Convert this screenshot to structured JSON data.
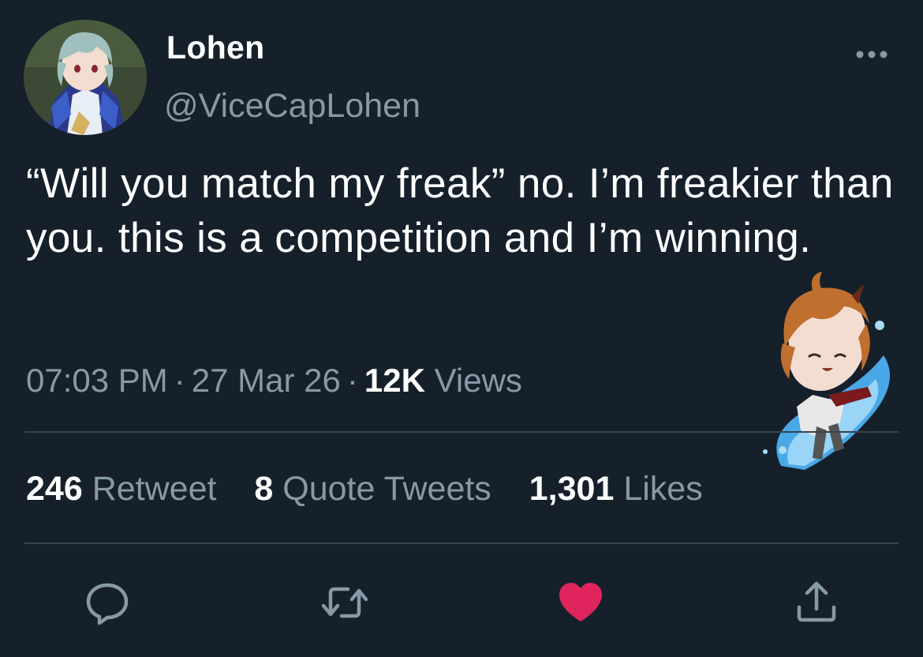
{
  "author": {
    "display_name": "Lohen",
    "handle": "@ViceCapLohen",
    "avatar_icon": "avatar-image"
  },
  "tweet": {
    "text": "“Will you match my freak” no. I’m freakier than you. this is a competition and I’m winning.",
    "time": "07:03 PM",
    "date": "27 Mar 26",
    "views_count": "12K",
    "views_label": "Views"
  },
  "stats": {
    "retweets_count": "246",
    "retweets_label": "Retweet",
    "quotes_count": "8",
    "quotes_label": "Quote Tweets",
    "likes_count": "1,301",
    "likes_label": "Likes"
  },
  "actions": {
    "reply_icon": "reply-icon",
    "retweet_icon": "retweet-icon",
    "like_icon": "heart-icon",
    "share_icon": "share-icon",
    "more_icon": "more-icon"
  },
  "colors": {
    "background": "#15202b",
    "secondary_text": "#8899a6",
    "divider": "#38444d",
    "like_active": "#e0245e"
  }
}
